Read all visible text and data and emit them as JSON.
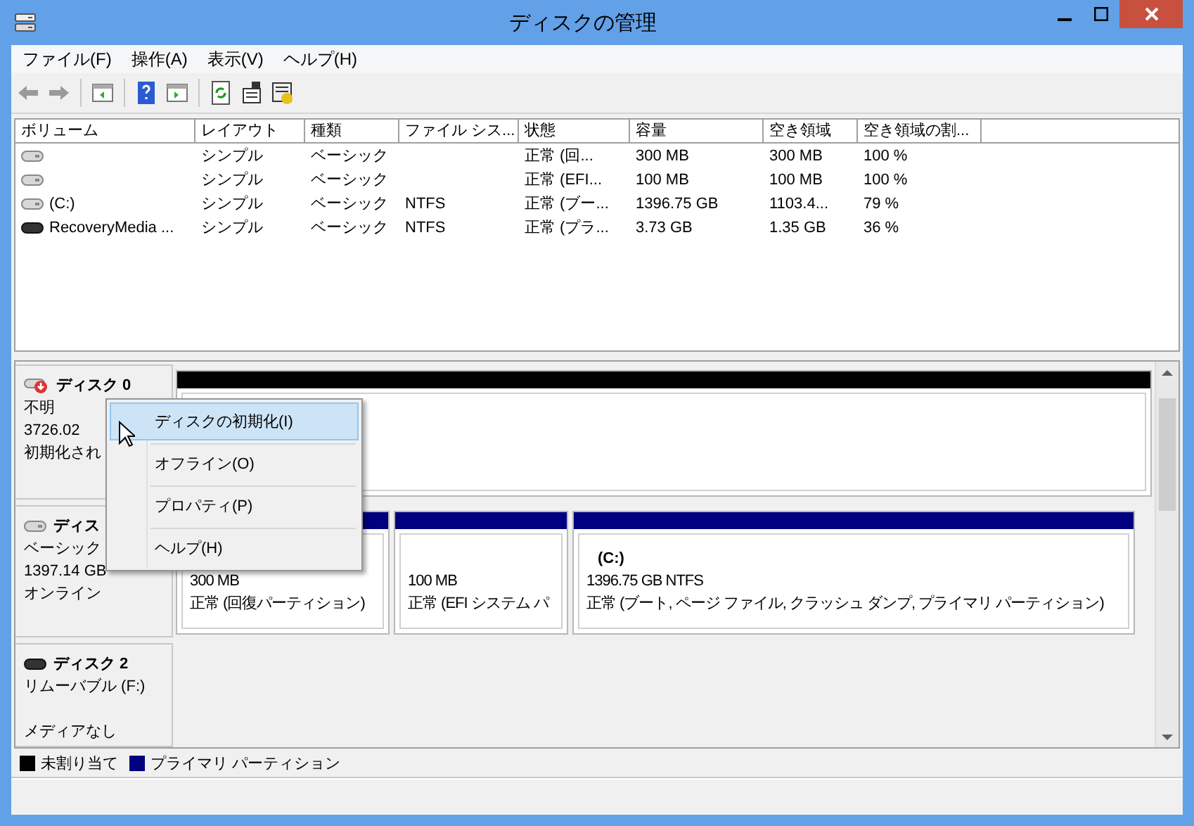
{
  "window": {
    "title": "ディスクの管理"
  },
  "menu": [
    "ファイル(F)",
    "操作(A)",
    "表示(V)",
    "ヘルプ(H)"
  ],
  "volumes": {
    "columns": [
      "ボリューム",
      "レイアウト",
      "種類",
      "ファイル シス...",
      "状態",
      "容量",
      "空き領域",
      "空き領域の割..."
    ],
    "rows": [
      {
        "kind": "fixed",
        "cells": [
          "",
          "シンプル",
          "ベーシック",
          "",
          "正常 (回...",
          "300 MB",
          "300 MB",
          "100 %"
        ]
      },
      {
        "kind": "fixed",
        "cells": [
          "",
          "シンプル",
          "ベーシック",
          "",
          "正常 (EFI...",
          "100 MB",
          "100 MB",
          "100 %"
        ]
      },
      {
        "kind": "fixed",
        "cells": [
          "(C:)",
          "シンプル",
          "ベーシック",
          "NTFS",
          "正常 (ブー...",
          "1396.75 GB",
          "1103.4...",
          "79 %"
        ]
      },
      {
        "kind": "removable",
        "cells": [
          "RecoveryMedia ...",
          "シンプル",
          "ベーシック",
          "NTFS",
          "正常 (プラ...",
          "3.73 GB",
          "1.35 GB",
          "36 %"
        ]
      }
    ]
  },
  "disks": [
    {
      "name": "ディスク 0",
      "kind": "uninitialized",
      "type": "不明",
      "size": "3726.02",
      "status": "初期化され",
      "partitions": [
        {
          "kind": "unallocated"
        }
      ]
    },
    {
      "name": "ディス",
      "kind": "fixed",
      "type": "ベーシック",
      "size": "1397.14 GB",
      "status": "オンライン",
      "partitions": [
        {
          "kind": "primary",
          "lines": [
            "300 MB",
            "正常 (回復パーティション)"
          ]
        },
        {
          "kind": "primary",
          "lines": [
            "100 MB",
            "正常 (EFI システム パ"
          ]
        },
        {
          "kind": "primary",
          "label": "(C:)",
          "lines": [
            "1396.75 GB NTFS",
            "正常 (ブート, ページ ファイル, クラッシュ ダンプ, プライマリ パーティション)"
          ]
        }
      ]
    },
    {
      "name": "ディスク 2",
      "kind": "removable",
      "type": "リムーバブル (F:)",
      "status": "メディアなし"
    }
  ],
  "legend": [
    {
      "label": "未割り当て",
      "color": "#000000"
    },
    {
      "label": "プライマリ パーティション",
      "color": "#000080"
    }
  ],
  "context_menu": [
    {
      "label": "ディスクの初期化(I)",
      "selected": true
    },
    {
      "label": "オフライン(O)",
      "selected": false
    },
    {
      "label": "プロパティ(P)",
      "selected": false
    },
    {
      "label": "ヘルプ(H)",
      "selected": false
    }
  ]
}
